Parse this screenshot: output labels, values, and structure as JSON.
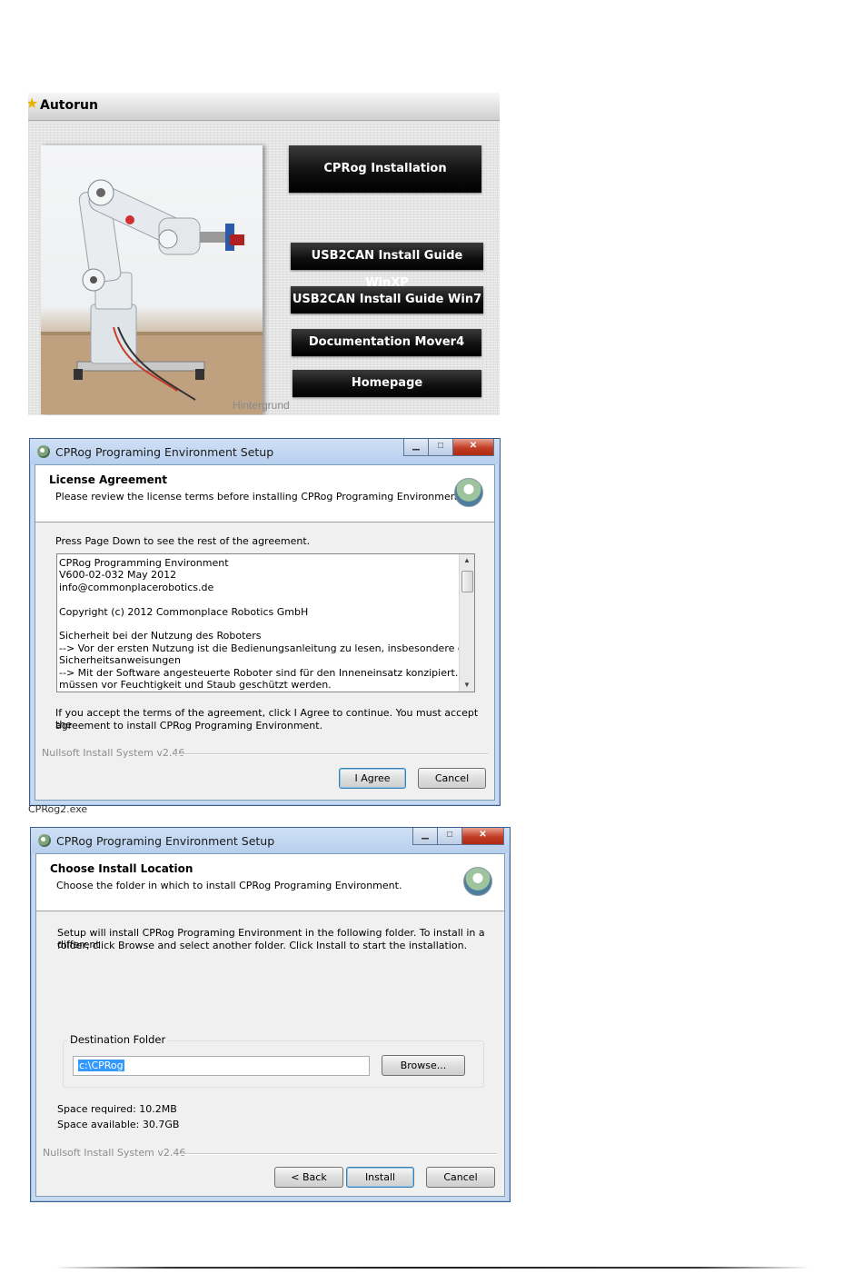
{
  "autorun": {
    "title": "Autorun",
    "buttons": {
      "installation": "CPRog Installation",
      "guide_winxp": "USB2CAN Install Guide WinXP",
      "guide_win7": "USB2CAN Install Guide Win7",
      "documentation": "Documentation Mover4",
      "homepage": "Homepage"
    },
    "photo_caption": "Hintergrund"
  },
  "license_dialog": {
    "title": "CPRog Programing Environment Setup",
    "header_title": "License Agreement",
    "header_subtitle": "Please review the license terms before installing CPRog Programing Environment.",
    "instruction": "Press Page Down to see the rest of the agreement.",
    "license_lines": [
      "CPRog Programming Environment",
      "V600-02-032 May  2012",
      "info@commonplacerobotics.de",
      "",
      "Copyright (c) 2012 Commonplace Robotics GmbH",
      "",
      "Sicherheit bei der Nutzung des Roboters",
      "--> Vor der ersten Nutzung ist die Bedienungsanleitung zu lesen, insbesondere die",
      "Sicherheitsanweisungen",
      "--> Mit der Software angesteuerte Roboter sind für den Inneneinsatz konzipiert. Sie",
      "müssen vor Feuchtigkeit und Staub geschützt werden."
    ],
    "accept_text_1": "If you accept the terms of the agreement, click I Agree to continue. You must accept the",
    "accept_text_2": "agreement to install CPRog Programing Environment.",
    "nsis_label": "Nullsoft Install System v2.46",
    "agree_button": "I Agree",
    "cancel_button": "Cancel",
    "under_fragment": "CPRog2.exe"
  },
  "install_dialog": {
    "title": "CPRog Programing Environment Setup",
    "header_title": "Choose Install Location",
    "header_subtitle": "Choose the folder in which to install CPRog Programing Environment.",
    "body_text_1": "Setup will install CPRog Programing Environment in the following folder. To install in a different",
    "body_text_2": "folder, click Browse and select another folder. Click Install to start the installation.",
    "destination_label": "Destination Folder",
    "destination_value": "c:\\CPRog",
    "browse_button": "Browse...",
    "space_required": "Space required: 10.2MB",
    "space_available": "Space available: 30.7GB",
    "nsis_label": "Nullsoft Install System v2.46",
    "back_button": "< Back",
    "install_button": "Install",
    "cancel_button": "Cancel"
  },
  "icons": {
    "window_minimize": "minimize-icon",
    "window_maximize": "maximize-icon",
    "window_close": "close-icon",
    "scroll_up": "scroll-up-icon",
    "scroll_down": "scroll-down-icon",
    "installer_logo": "nsis-installer-icon",
    "autorun_star": "star-icon"
  },
  "colors": {
    "autorun_button_bg": "#111111",
    "dialog_frame": "#c5d9f1",
    "close_button": "#c23d25",
    "selection": "#3399ff"
  }
}
